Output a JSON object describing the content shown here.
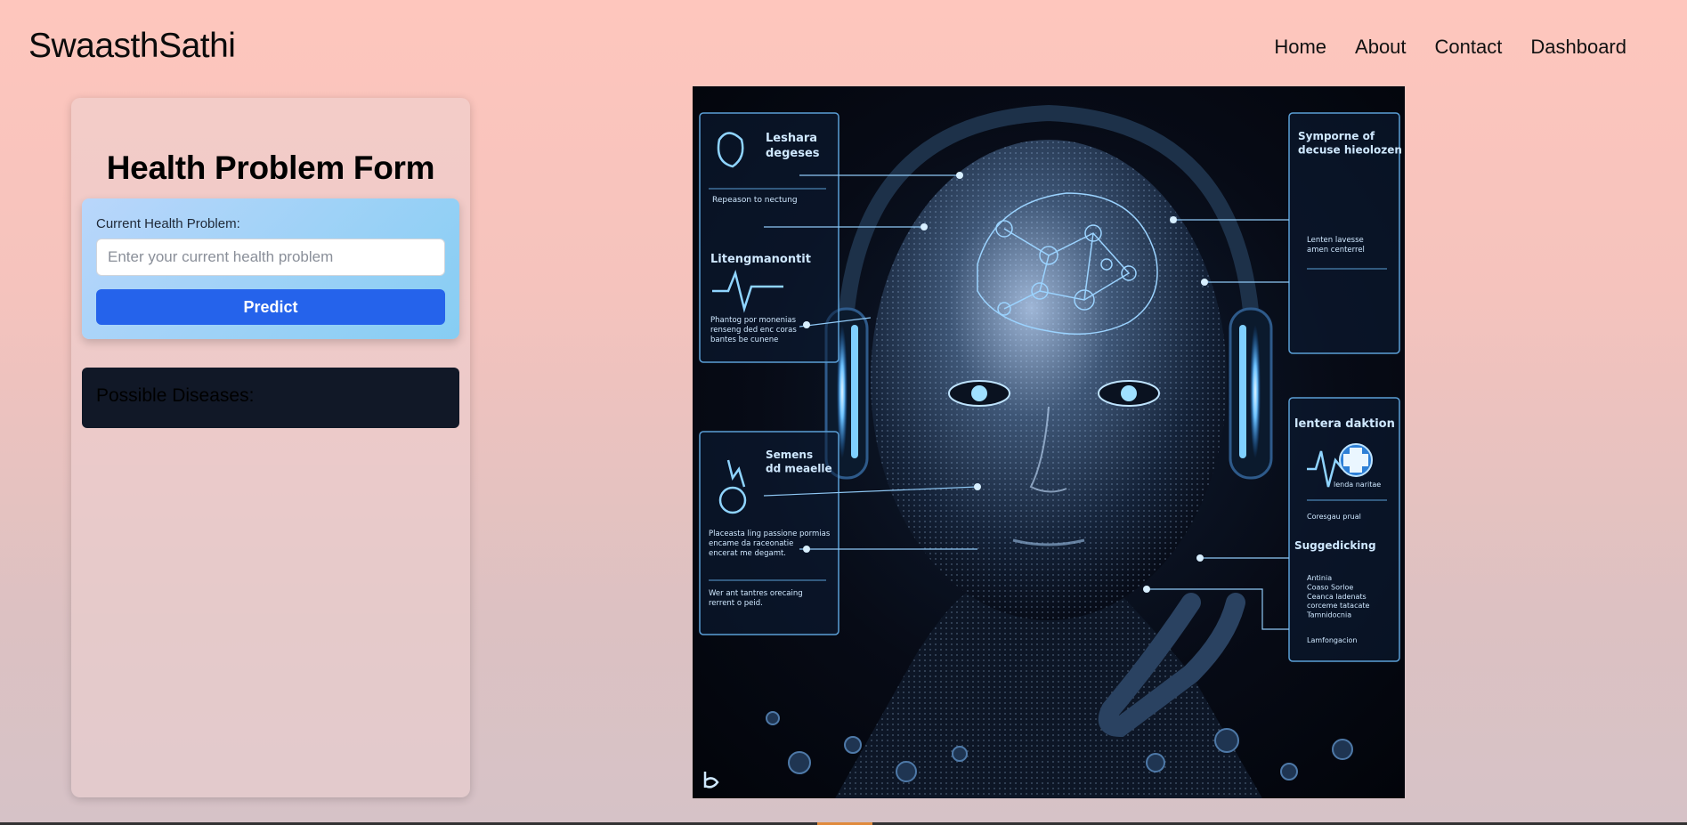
{
  "brand": "SwaasthSathi",
  "nav": {
    "home": "Home",
    "about": "About",
    "contact": "Contact",
    "dashboard": "Dashboard"
  },
  "form": {
    "title": "Health Problem Form",
    "label": "Current Health Problem:",
    "placeholder": "Enter your current health problem",
    "value": "",
    "submit_label": "Predict"
  },
  "results": {
    "title": "Possible Diseases:"
  },
  "hero": {
    "panel_1_title": "Leshara\ndegeses",
    "panel_1_caption": "Repeason to nectung",
    "panel_2_title": "Litengmanontit",
    "panel_2_body": "Phantog por monenias\nrenseng ded enc coras\nbantes be cunene",
    "panel_3_title": "Symporne of\ndecuse hieolozen",
    "panel_3_body": "Lenten lavesse\namen centerrel",
    "panel_4_title": "Semens\ndd meaelle",
    "panel_4_body": "Placeasta ling passione pormias\nencame da raceonatie\nencerat me degamt.",
    "panel_4_footer": "Wer ant tantres orecaing\nrerrent o peid.",
    "panel_5_title": "lentera daktion",
    "panel_5_caption": "lenda naritae",
    "panel_5_sub": "Coresgau prual",
    "panel_6_title": "Suggedicking",
    "panel_6_body": "Antinia\nCoaso Sorloe\nCeanca ladenats\ncorceme tatacate\nTamnidocnia",
    "panel_6_footer": "Lamfongacion"
  }
}
